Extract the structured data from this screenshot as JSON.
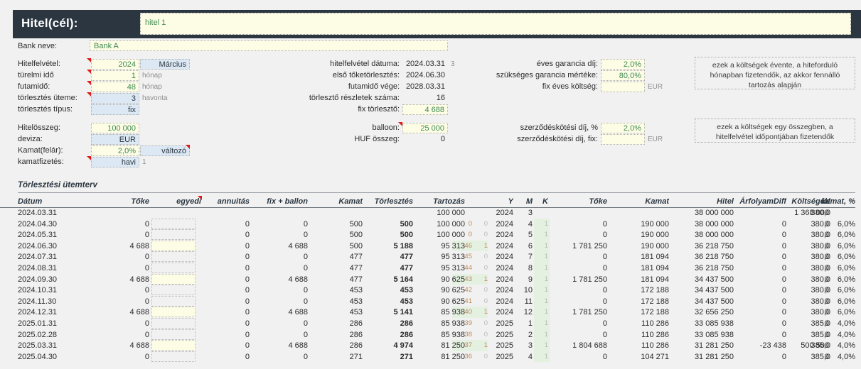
{
  "header": {
    "title": "Hitel(cél):",
    "title_value": "hitel 1"
  },
  "form": {
    "bank_label": "Bank neve:",
    "bank_value": "Bank A",
    "left": [
      {
        "label": "Hitelfelvétel:",
        "value": "2024",
        "style": "yellow",
        "extra": "Március",
        "extra_style": "blue",
        "comment": true
      },
      {
        "label": "türelmi idő",
        "value": "1",
        "style": "yellow",
        "unit": "hónap",
        "comment": true
      },
      {
        "label": "futamidő:",
        "value": "48",
        "style": "yellow",
        "unit": "hónap",
        "comment": true
      },
      {
        "label": "törlesztés üteme:",
        "value": "3",
        "style": "blue",
        "unit": "havonta",
        "comment": true
      },
      {
        "label": "törlesztés típus:",
        "value": "fix",
        "style": "blue"
      }
    ],
    "left2": [
      {
        "label": "Hitelösszeg:",
        "value": "100 000",
        "style": "yellow"
      },
      {
        "label": "deviza:",
        "value": "EUR",
        "style": "blue"
      },
      {
        "label": "Kamat(felár):",
        "value": "2,0%",
        "style": "yellow",
        "extra": "változó",
        "extra_style": "blue",
        "comment_extra": true
      },
      {
        "label": "kamatfizetés:",
        "value": "havi",
        "style": "blue",
        "unit": "1",
        "comment": true
      }
    ],
    "mid": [
      {
        "label": "hitelfelvétel dátuma:",
        "value": "2024.03.31",
        "style": "plain",
        "unit": "3"
      },
      {
        "label": "első tőketörlesztés:",
        "value": "2024.06.30",
        "style": "plain"
      },
      {
        "label": "futamidő vége:",
        "value": "2028.03.31",
        "style": "plain"
      },
      {
        "label": "törlesztő részletek száma:",
        "value": "16",
        "style": "plain"
      },
      {
        "label": "fix törlesztő:",
        "value": "4 688",
        "style": "yellow"
      }
    ],
    "mid2": [
      {
        "label": "balloon:",
        "value": "25 000",
        "style": "yellow",
        "comment": true
      },
      {
        "label": "HUF összeg:",
        "value": "0",
        "style": "plain"
      }
    ],
    "right": [
      {
        "label": "éves garancia díj:",
        "value": "2,0%",
        "style": "yellow"
      },
      {
        "label": "szükséges garancia mértéke:",
        "value": "80,0%",
        "style": "yellow"
      },
      {
        "label": "fix éves költség:",
        "value": "",
        "style": "empty",
        "unit": "EUR"
      }
    ],
    "right2": [
      {
        "label": "szerződéskötési díj, %",
        "value": "2,0%",
        "style": "yellow"
      },
      {
        "label": "szerződéskötési díj, fix:",
        "value": "",
        "style": "empty",
        "unit": "EUR"
      }
    ],
    "notes": [
      "ezek a költségek évente, a hiteforduló hónapban fizetendők, az akkor fennálló tartozás alapján",
      "ezek a költségek egy összegben, a hitelfelvétel időpontjában fizetendők"
    ]
  },
  "schedule": {
    "section_title": "Törlesztési ütemterv",
    "columns": [
      "Dátum",
      "Tőke",
      "egyedi",
      "annuitás",
      "fix + ballon",
      "Kamat",
      "Törlesztés",
      "Tartozás",
      "",
      "",
      "Y",
      "M",
      "K",
      "Tőke",
      "Kamat",
      "Hitel",
      "ÁrfolyamDiff",
      "Költségek",
      "árf",
      "kamat, %"
    ],
    "rows": [
      {
        "datum": "2024.03.31",
        "toke": "",
        "egyedi": false,
        "annuitas": "",
        "fixballon": "",
        "kamat": "",
        "torlesztes": "",
        "tartozas": "100 000",
        "cnt": "",
        "flag": "",
        "y": "2024",
        "m": "3",
        "k": "",
        "toke2": "",
        "kamat2": "",
        "hitel": "38 000 000",
        "arfdiff": "",
        "koltsegek": "1 368 000",
        "arf": "380,0",
        "kamatpct": ""
      },
      {
        "datum": "2024.04.30",
        "toke": "0",
        "egyedi": false,
        "annuitas": "0",
        "fixballon": "0",
        "kamat": "500",
        "torlesztes": "500",
        "tartozas": "100 000",
        "cnt": "0",
        "flag": "0",
        "y": "2024",
        "m": "4",
        "k": "1",
        "toke2": "0",
        "kamat2": "190 000",
        "hitel": "38 000 000",
        "arfdiff": "0",
        "koltsegek": "0",
        "arf": "380,0",
        "kamatpct": "6,0%"
      },
      {
        "datum": "2024.05.31",
        "toke": "0",
        "egyedi": false,
        "annuitas": "0",
        "fixballon": "0",
        "kamat": "500",
        "torlesztes": "500",
        "tartozas": "100 000",
        "cnt": "0",
        "flag": "0",
        "y": "2024",
        "m": "5",
        "k": "1",
        "toke2": "0",
        "kamat2": "190 000",
        "hitel": "38 000 000",
        "arfdiff": "0",
        "koltsegek": "0",
        "arf": "380,0",
        "kamatpct": "6,0%"
      },
      {
        "datum": "2024.06.30",
        "toke": "4 688",
        "egyedi": true,
        "annuitas": "0",
        "fixballon": "4 688",
        "kamat": "500",
        "torlesztes": "5 188",
        "tartozas": "95 313",
        "cnt": "46",
        "flag": "1",
        "y": "2024",
        "m": "6",
        "k": "1",
        "toke2": "1 781 250",
        "kamat2": "190 000",
        "hitel": "36 218 750",
        "arfdiff": "0",
        "koltsegek": "0",
        "arf": "380,0",
        "kamatpct": "6,0%"
      },
      {
        "datum": "2024.07.31",
        "toke": "0",
        "egyedi": false,
        "annuitas": "0",
        "fixballon": "0",
        "kamat": "477",
        "torlesztes": "477",
        "tartozas": "95 313",
        "cnt": "45",
        "flag": "0",
        "y": "2024",
        "m": "7",
        "k": "1",
        "toke2": "0",
        "kamat2": "181 094",
        "hitel": "36 218 750",
        "arfdiff": "0",
        "koltsegek": "0",
        "arf": "380,0",
        "kamatpct": "6,0%"
      },
      {
        "datum": "2024.08.31",
        "toke": "0",
        "egyedi": false,
        "annuitas": "0",
        "fixballon": "0",
        "kamat": "477",
        "torlesztes": "477",
        "tartozas": "95 313",
        "cnt": "44",
        "flag": "0",
        "y": "2024",
        "m": "8",
        "k": "1",
        "toke2": "0",
        "kamat2": "181 094",
        "hitel": "36 218 750",
        "arfdiff": "0",
        "koltsegek": "0",
        "arf": "380,0",
        "kamatpct": "6,0%"
      },
      {
        "datum": "2024.09.30",
        "toke": "4 688",
        "egyedi": true,
        "annuitas": "0",
        "fixballon": "4 688",
        "kamat": "477",
        "torlesztes": "5 164",
        "tartozas": "90 625",
        "cnt": "43",
        "flag": "1",
        "y": "2024",
        "m": "9",
        "k": "1",
        "toke2": "1 781 250",
        "kamat2": "181 094",
        "hitel": "34 437 500",
        "arfdiff": "0",
        "koltsegek": "0",
        "arf": "380,0",
        "kamatpct": "6,0%"
      },
      {
        "datum": "2024.10.31",
        "toke": "0",
        "egyedi": false,
        "annuitas": "0",
        "fixballon": "0",
        "kamat": "453",
        "torlesztes": "453",
        "tartozas": "90 625",
        "cnt": "42",
        "flag": "0",
        "y": "2024",
        "m": "10",
        "k": "1",
        "toke2": "0",
        "kamat2": "172 188",
        "hitel": "34 437 500",
        "arfdiff": "0",
        "koltsegek": "0",
        "arf": "380,0",
        "kamatpct": "6,0%"
      },
      {
        "datum": "2024.11.30",
        "toke": "0",
        "egyedi": false,
        "annuitas": "0",
        "fixballon": "0",
        "kamat": "453",
        "torlesztes": "453",
        "tartozas": "90 625",
        "cnt": "41",
        "flag": "0",
        "y": "2024",
        "m": "11",
        "k": "1",
        "toke2": "0",
        "kamat2": "172 188",
        "hitel": "34 437 500",
        "arfdiff": "0",
        "koltsegek": "0",
        "arf": "380,0",
        "kamatpct": "6,0%"
      },
      {
        "datum": "2024.12.31",
        "toke": "4 688",
        "egyedi": true,
        "annuitas": "0",
        "fixballon": "4 688",
        "kamat": "453",
        "torlesztes": "5 141",
        "tartozas": "85 938",
        "cnt": "40",
        "flag": "1",
        "y": "2024",
        "m": "12",
        "k": "1",
        "toke2": "1 781 250",
        "kamat2": "172 188",
        "hitel": "32 656 250",
        "arfdiff": "0",
        "koltsegek": "0",
        "arf": "380,0",
        "kamatpct": "6,0%"
      },
      {
        "datum": "2025.01.31",
        "toke": "0",
        "egyedi": false,
        "annuitas": "0",
        "fixballon": "0",
        "kamat": "286",
        "torlesztes": "286",
        "tartozas": "85 938",
        "cnt": "39",
        "flag": "0",
        "y": "2025",
        "m": "1",
        "k": "1",
        "toke2": "0",
        "kamat2": "110 286",
        "hitel": "33 085 938",
        "arfdiff": "0",
        "koltsegek": "0",
        "arf": "385,0",
        "kamatpct": "4,0%"
      },
      {
        "datum": "2025.02.28",
        "toke": "0",
        "egyedi": false,
        "annuitas": "0",
        "fixballon": "0",
        "kamat": "286",
        "torlesztes": "286",
        "tartozas": "85 938",
        "cnt": "38",
        "flag": "0",
        "y": "2025",
        "m": "2",
        "k": "1",
        "toke2": "0",
        "kamat2": "110 286",
        "hitel": "33 085 938",
        "arfdiff": "0",
        "koltsegek": "0",
        "arf": "385,0",
        "kamatpct": "4,0%"
      },
      {
        "datum": "2025.03.31",
        "toke": "4 688",
        "egyedi": true,
        "annuitas": "0",
        "fixballon": "4 688",
        "kamat": "286",
        "torlesztes": "4 974",
        "tartozas": "81 250",
        "cnt": "37",
        "flag": "1",
        "y": "2025",
        "m": "3",
        "k": "1",
        "toke2": "1 804 688",
        "kamat2": "110 286",
        "hitel": "31 281 250",
        "arfdiff": "-23 438",
        "koltsegek": "500 500",
        "arf": "385,0",
        "kamatpct": "4,0%"
      },
      {
        "datum": "2025.04.30",
        "toke": "0",
        "egyedi": false,
        "annuitas": "0",
        "fixballon": "0",
        "kamat": "271",
        "torlesztes": "271",
        "tartozas": "81 250",
        "cnt": "36",
        "flag": "0",
        "y": "2025",
        "m": "4",
        "k": "1",
        "toke2": "0",
        "kamat2": "104 271",
        "hitel": "31 281 250",
        "arfdiff": "0",
        "koltsegek": "0",
        "arf": "385,0",
        "kamatpct": "4,0%"
      }
    ]
  },
  "colors": {
    "header_bar": "#2b3640",
    "input_yellow": "#fdfde6",
    "input_blue": "#dce9f5",
    "helper_green": "#e4f0e0",
    "value_green": "#3f8a4f",
    "counter_orange": "#c08a5a",
    "comment_red": "#e01b1b"
  }
}
